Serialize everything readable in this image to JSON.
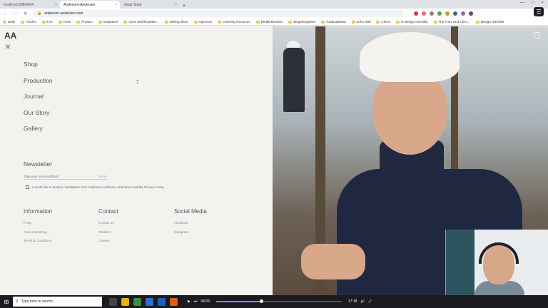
{
  "browser": {
    "tabs": [
      {
        "label": "localhost:8080/404",
        "active": false
      },
      {
        "label": "Andersen-Andersen",
        "active": true
      },
      {
        "label": "Vlady Studi",
        "active": false
      }
    ],
    "url": "andersen-andersen.com",
    "bookmarks": [
      "Daily",
      "Articles",
      "Fun",
      "Tools",
      "Product",
      "Inspiration",
      "Icons and illustratio...",
      "Writing ideas",
      "Agencies",
      "Learning resources",
      "Reddit Browser",
      "Blogbetingelser",
      "Graduateland",
      "Zoho Mail",
      "Clevio",
      "UI design checklist",
      "The Front End Chec...",
      "Design checklist"
    ]
  },
  "site": {
    "logo": "AA",
    "close": "×",
    "nav": [
      "Shop",
      "Production",
      "Journal",
      "Our Story",
      "Gallery"
    ],
    "newsletter": {
      "title": "Newsletter",
      "placeholder": "Type your email address",
      "send": "Send ›",
      "consent": "I would like to receive newsletters from Andersen-Andersen and have read the Privacy Policy"
    },
    "footer": [
      {
        "heading": "Information",
        "links": [
          "FAQs",
          "Care & Washing",
          "Terms & Conditions"
        ]
      },
      {
        "heading": "Contact",
        "links": [
          "Contact us",
          "Retailers",
          "Careers"
        ]
      },
      {
        "heading": "Social Media",
        "links": [
          "Facebook",
          "Instagram"
        ]
      }
    ]
  },
  "taskbar": {
    "search_placeholder": "Type here to search",
    "time_current": "08:03",
    "time_total": "17:18",
    "progress": 0.36
  },
  "colors": {
    "page_bg": "#f3f2ef",
    "sweater": "#1f2840",
    "progress": "#4aa3ff"
  }
}
